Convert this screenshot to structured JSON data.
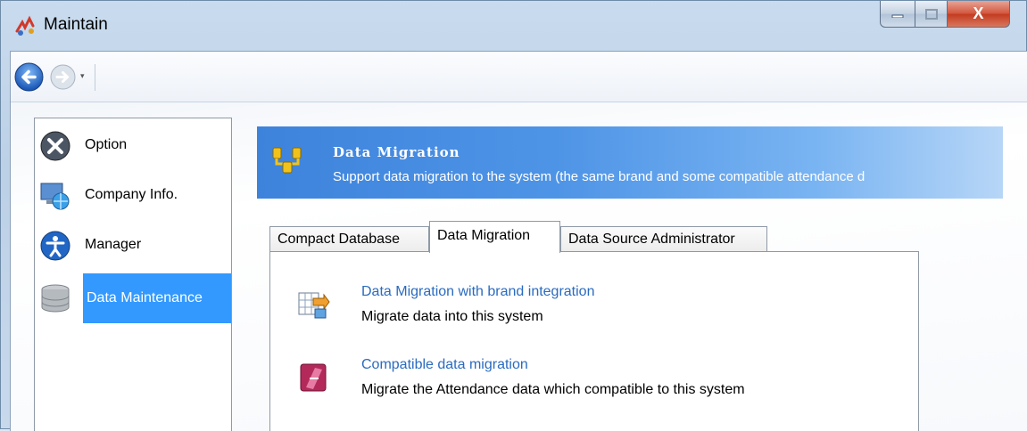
{
  "window": {
    "title": "Maintain",
    "close_glyph": "X",
    "min_glyph": "—",
    "max_glyph": "☐"
  },
  "toolbar": {
    "back_icon": "back-arrow-icon",
    "forward_icon": "forward-arrow-icon",
    "history_dropdown_glyph": "▾"
  },
  "sidebar": {
    "items": [
      {
        "label": "Option",
        "icon": "tools-icon",
        "selected": false
      },
      {
        "label": "Company Info.",
        "icon": "monitor-globe-icon",
        "selected": false
      },
      {
        "label": "Manager",
        "icon": "person-accessibility-icon",
        "selected": false
      },
      {
        "label": "Data Maintenance",
        "icon": "database-icon",
        "selected": true
      }
    ]
  },
  "banner": {
    "title": "Data Migration",
    "subtitle": "Support data migration to the system (the same brand and some compatible  attendance d"
  },
  "tabs": [
    {
      "label": "Compact Database",
      "active": false
    },
    {
      "label": "Data Migration",
      "active": true
    },
    {
      "label": "Data Source Administrator",
      "active": false
    }
  ],
  "actions": [
    {
      "title": "Data Migration with brand integration",
      "description": "Migrate data into this system",
      "icon": "table-migrate-icon"
    },
    {
      "title": "Compatible  data migration",
      "description": "Migrate the Attendance data which compatible  to this system",
      "icon": "access-database-icon"
    }
  ],
  "colors": {
    "selection": "#3399ff",
    "link": "#2a6bc0",
    "banner_start": "#3d83dc"
  }
}
